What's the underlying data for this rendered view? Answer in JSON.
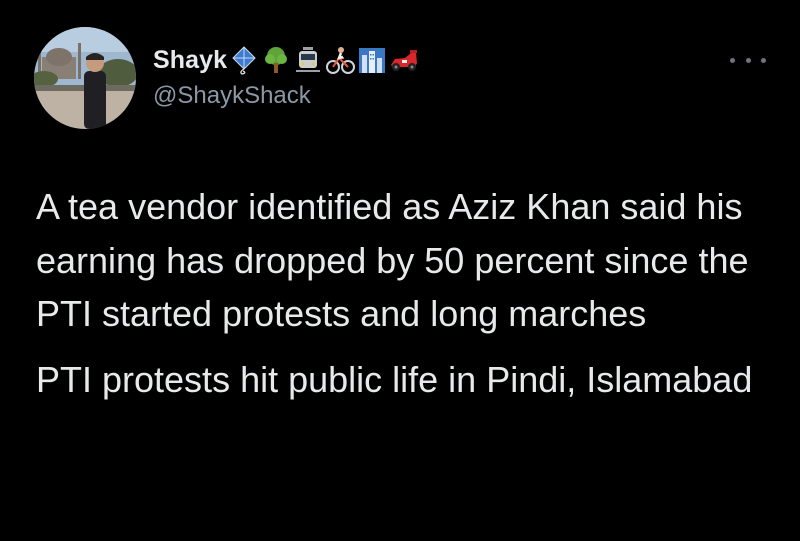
{
  "author": {
    "display_name": "Shayk",
    "handle": "@ShaykShack",
    "name_emojis": [
      "kite-emoji",
      "tree-emoji",
      "tram-emoji",
      "cyclist-emoji",
      "cityscape-emoji",
      "race-car-emoji"
    ]
  },
  "tweet": {
    "paragraphs": [
      "A tea vendor identified as Aziz Khan said his earning has dropped by 50 percent since the PTI started protests and long marches",
      "PTI protests hit public life in Pindi, Islamabad"
    ]
  },
  "icons": {
    "more": "more-horizontal-icon"
  },
  "colors": {
    "background": "#000000",
    "primary_text": "#e7e9ea",
    "secondary_text": "#8b98a5"
  }
}
